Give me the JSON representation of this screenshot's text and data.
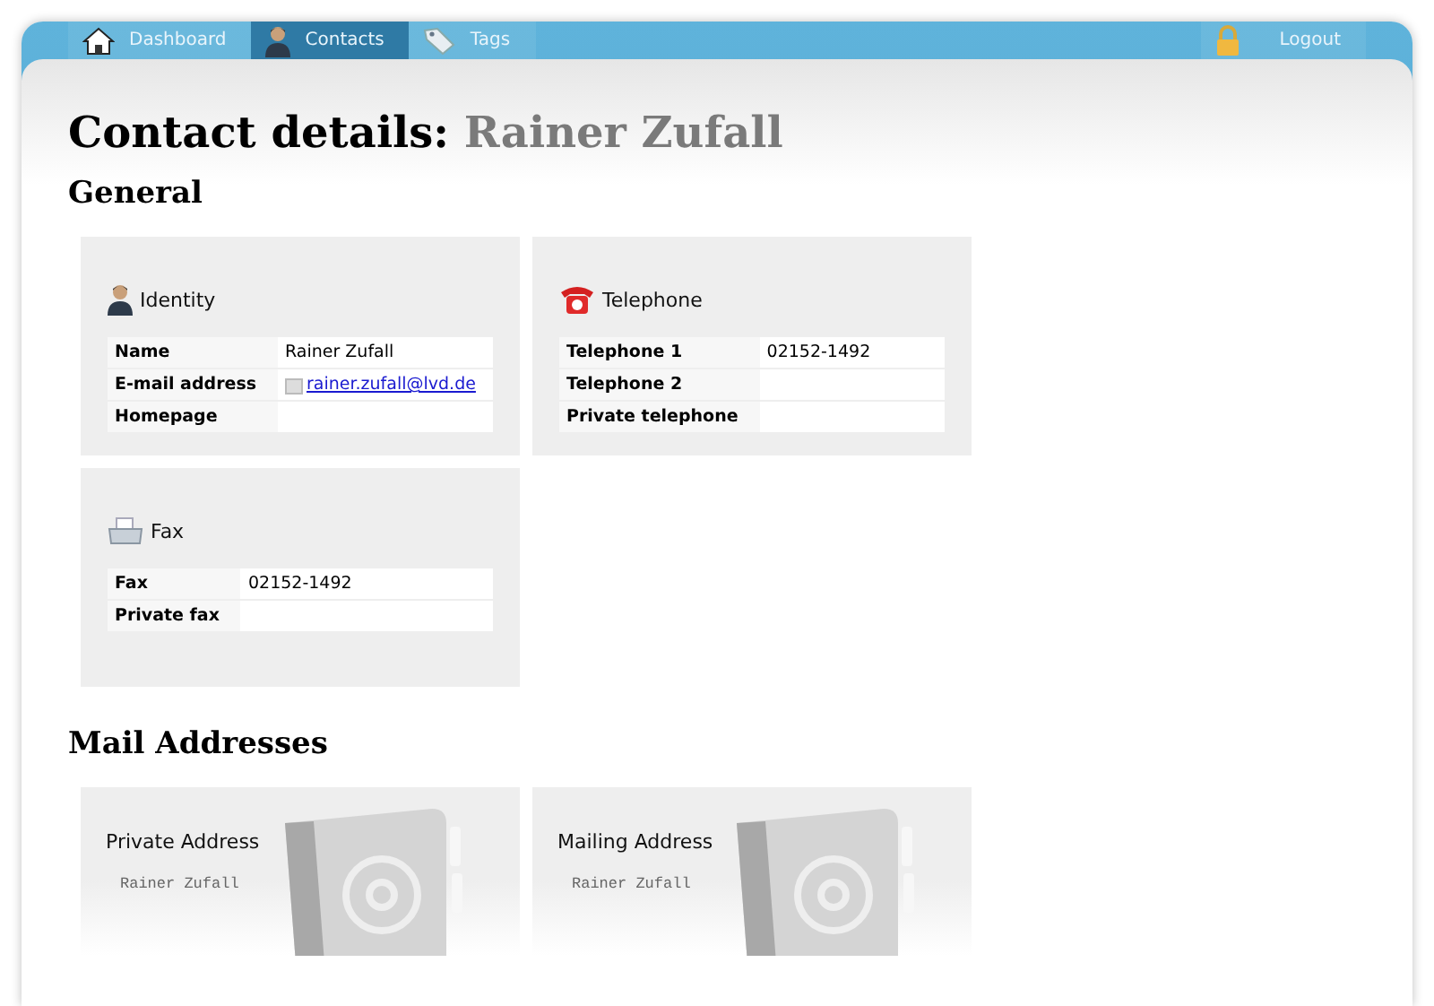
{
  "nav": {
    "items": [
      {
        "label": "Dashboard",
        "kind": "house",
        "selected": false
      },
      {
        "label": "Contacts",
        "kind": "person",
        "selected": true
      },
      {
        "label": "Tags",
        "kind": "tag",
        "selected": false
      }
    ],
    "logout": "Logout"
  },
  "title": {
    "prefix": "Contact details:",
    "name": "Rainer Zufall"
  },
  "general": {
    "heading": "General",
    "cards": [
      {
        "title": "Identity",
        "kind": "person",
        "rows": [
          {
            "label": "Name",
            "value": "Rainer Zufall",
            "kind": "text"
          },
          {
            "label": "E-mail address",
            "value": "rainer.zufall@lvd.de",
            "kind": "email"
          },
          {
            "label": "Homepage",
            "value": "",
            "kind": "text"
          }
        ]
      },
      {
        "title": "Telephone",
        "kind": "phone",
        "rows": [
          {
            "label": "Telephone 1",
            "value": "02152-1492",
            "kind": "text"
          },
          {
            "label": "Telephone 2",
            "value": "",
            "kind": "text"
          },
          {
            "label": "Private telephone",
            "value": "",
            "kind": "text"
          }
        ]
      },
      {
        "title": "Fax",
        "kind": "fax",
        "rows": [
          {
            "label": "Fax",
            "value": "02152-1492",
            "kind": "text"
          },
          {
            "label": "Private fax",
            "value": "",
            "kind": "text"
          }
        ]
      }
    ]
  },
  "mail": {
    "heading": "Mail Addresses",
    "cards": [
      {
        "title": "Private Address",
        "line": "Rainer Zufall"
      },
      {
        "title": "Mailing Address",
        "line": "Rainer Zufall"
      }
    ]
  }
}
